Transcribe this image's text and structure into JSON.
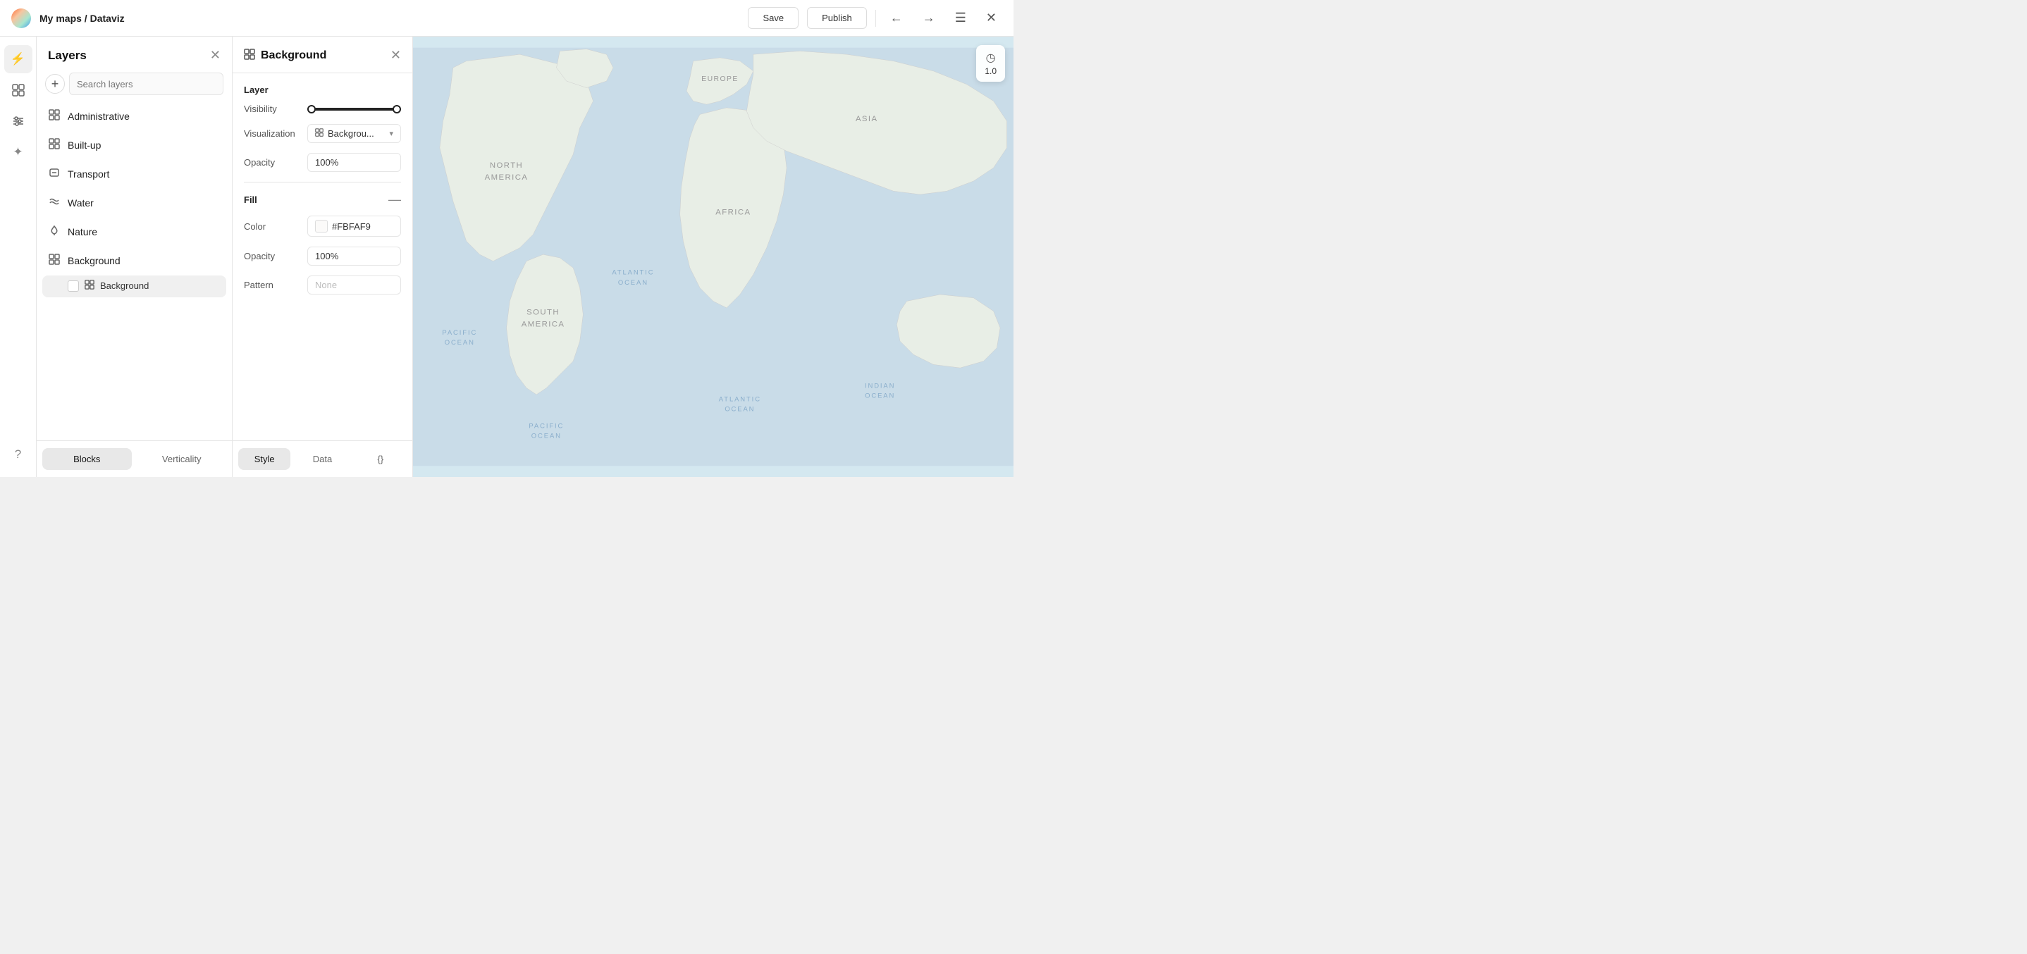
{
  "topbar": {
    "logo_alt": "app-logo",
    "breadcrumb_prefix": "My maps / ",
    "project_name": "Dataviz",
    "save_label": "Save",
    "publish_label": "Publish",
    "back_icon": "←",
    "forward_icon": "→",
    "menu_icon": "☰",
    "close_icon": "✕"
  },
  "iconbar": {
    "items": [
      {
        "id": "lightning",
        "icon": "⚡",
        "active": true
      },
      {
        "id": "layers",
        "icon": "◧",
        "active": false
      },
      {
        "id": "sliders",
        "icon": "⊟",
        "active": false
      },
      {
        "id": "sparkle",
        "icon": "✦",
        "active": false
      }
    ],
    "bottom": {
      "id": "help",
      "icon": "?"
    }
  },
  "layers_panel": {
    "title": "Layers",
    "close_icon": "✕",
    "add_icon": "+",
    "search_placeholder": "Search layers",
    "layers": [
      {
        "id": "administrative",
        "name": "Administrative",
        "icon": "⊞"
      },
      {
        "id": "built-up",
        "name": "Built-up",
        "icon": "⊞"
      },
      {
        "id": "transport",
        "name": "Transport",
        "icon": "⊟"
      },
      {
        "id": "water",
        "name": "Water",
        "icon": "≈"
      },
      {
        "id": "nature",
        "name": "Nature",
        "icon": "✿"
      },
      {
        "id": "background",
        "name": "Background",
        "icon": "⊞"
      }
    ],
    "sub_item": {
      "name": "Background",
      "icon": "⊞"
    },
    "footer": {
      "blocks_label": "Blocks",
      "verticality_label": "Verticality"
    }
  },
  "props_panel": {
    "icon": "⊞",
    "title": "Background",
    "close_icon": "✕",
    "layer_section": "Layer",
    "visibility_label": "Visibility",
    "visualization_label": "Visualization",
    "visualization_value": "Backgrou...",
    "opacity_label": "Opacity",
    "opacity_value": "100%",
    "fill_section": "Fill",
    "fill_collapse_icon": "—",
    "color_label": "Color",
    "color_value": "#FBFAF9",
    "color_hex": "#FBFAF9",
    "fill_opacity_label": "Opacity",
    "fill_opacity_value": "100%",
    "pattern_label": "Pattern",
    "pattern_placeholder": "None",
    "footer": {
      "style_label": "Style",
      "data_label": "Data",
      "code_label": "{}"
    }
  },
  "map": {
    "corner_icon": "◷",
    "corner_value": "1.0"
  }
}
